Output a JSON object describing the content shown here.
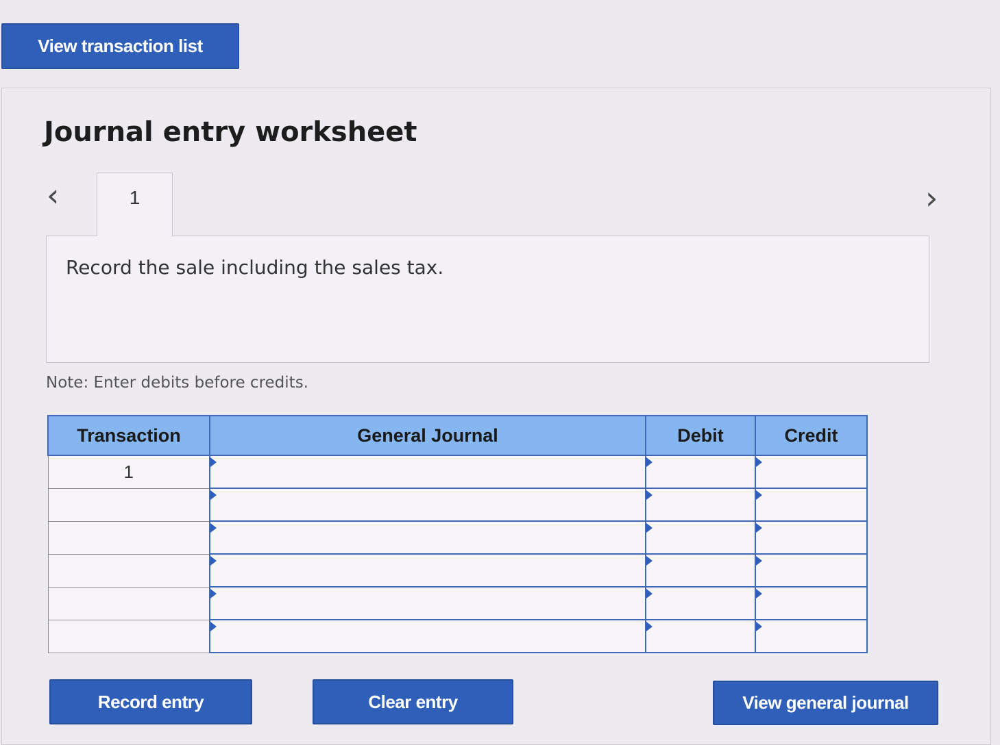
{
  "top_button": "View transaction list",
  "title": "Journal entry worksheet",
  "nav": {
    "prev_icon": "chevron-left-icon",
    "next_icon": "chevron-right-icon",
    "tab_label": "1"
  },
  "instruction": "Record the sale including the sales tax.",
  "note": "Note: Enter debits before credits.",
  "table": {
    "headers": {
      "transaction": "Transaction",
      "general_journal": "General Journal",
      "debit": "Debit",
      "credit": "Credit"
    },
    "rows": [
      {
        "transaction": "1",
        "account": "",
        "debit": "",
        "credit": ""
      },
      {
        "transaction": "",
        "account": "",
        "debit": "",
        "credit": ""
      },
      {
        "transaction": "",
        "account": "",
        "debit": "",
        "credit": ""
      },
      {
        "transaction": "",
        "account": "",
        "debit": "",
        "credit": ""
      },
      {
        "transaction": "",
        "account": "",
        "debit": "",
        "credit": ""
      },
      {
        "transaction": "",
        "account": "",
        "debit": "",
        "credit": ""
      }
    ]
  },
  "buttons": {
    "record": "Record entry",
    "clear": "Clear entry",
    "view_journal": "View general journal"
  },
  "colors": {
    "button": "#2f5fb8",
    "header": "#85b6f0",
    "grid": "#3e68b8"
  }
}
